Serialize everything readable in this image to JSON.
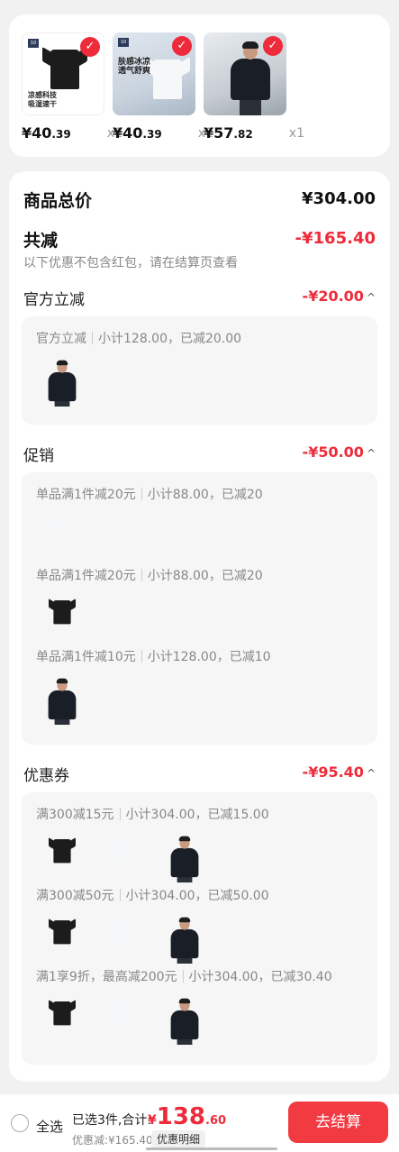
{
  "products": [
    {
      "price_main": "¥40",
      "price_dec": ".39",
      "qty": "x1",
      "image": "black-tee",
      "caption": "凉感科技\n吸湿速干",
      "selected": true
    },
    {
      "price_main": "¥40",
      "price_dec": ".39",
      "qty": "x1",
      "image": "white-tee",
      "caption": "肤感冰凉\n透气舒爽",
      "selected": true
    },
    {
      "price_main": "¥57",
      "price_dec": ".82",
      "qty": "x1",
      "image": "man-polo",
      "selected": true
    }
  ],
  "summary": {
    "goods_total_label": "商品总价",
    "goods_total_value": "¥304.00",
    "discount_label": "共减",
    "discount_value": "-¥165.40",
    "note": "以下优惠不包含红包，请在结算页查看"
  },
  "sections": {
    "official": {
      "title": "官方立减",
      "amount": "-¥20.00",
      "lines": [
        {
          "label": "官方立减",
          "detail": "小计128.00，已减20.00"
        }
      ]
    },
    "promo": {
      "title": "促销",
      "amount": "-¥50.00",
      "lines": [
        {
          "label": "单品满1件减20元",
          "detail": "小计88.00，已减20"
        },
        {
          "label": "单品满1件减20元",
          "detail": "小计88.00，已减20"
        },
        {
          "label": "单品满1件减10元",
          "detail": "小计128.00，已减10"
        }
      ]
    },
    "coupon": {
      "title": "优惠券",
      "amount": "-¥95.40",
      "lines": [
        {
          "label": "满300减15元",
          "detail": "小计304.00，已减15.00"
        },
        {
          "label": "满300减50元",
          "detail": "小计304.00，已减50.00"
        },
        {
          "label": "满1享9折，最高减200元",
          "detail": "小计304.00，已减30.40"
        }
      ]
    }
  },
  "bottom_bar": {
    "select_all": "全选",
    "selected_text": "已选3件,合计:",
    "total_yen": "¥",
    "total_int": "138",
    "total_dec": ".60",
    "saved": "优惠减:¥165.40",
    "detail_btn": "优惠明细",
    "checkout": "去结算"
  },
  "colors": {
    "accent": "#ee2b3a",
    "background": "#f1f1f1",
    "card": "#ffffff"
  },
  "icons": {
    "check": "check-icon",
    "caret": "chevron-up-icon",
    "radio": "radio-unchecked-icon"
  }
}
